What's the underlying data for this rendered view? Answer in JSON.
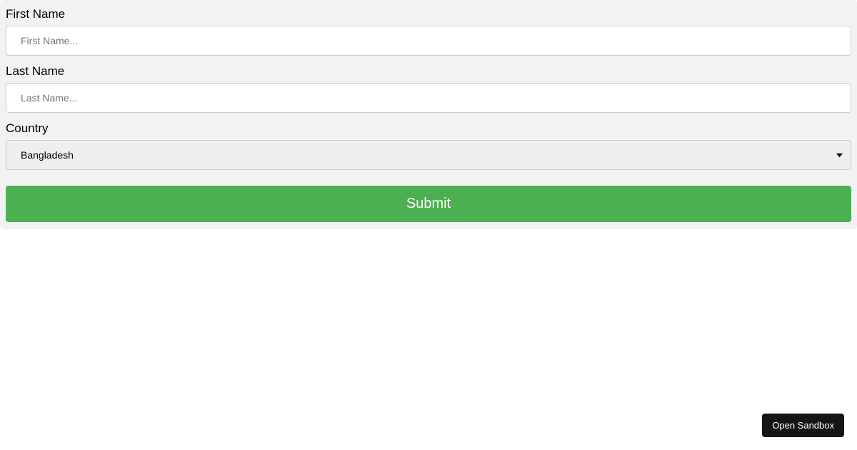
{
  "form": {
    "firstName": {
      "label": "First Name",
      "placeholder": "First Name...",
      "value": ""
    },
    "lastName": {
      "label": "Last Name",
      "placeholder": "Last Name...",
      "value": ""
    },
    "country": {
      "label": "Country",
      "selected": "Bangladesh"
    },
    "submitLabel": "Submit"
  },
  "footer": {
    "openSandboxLabel": "Open Sandbox"
  }
}
